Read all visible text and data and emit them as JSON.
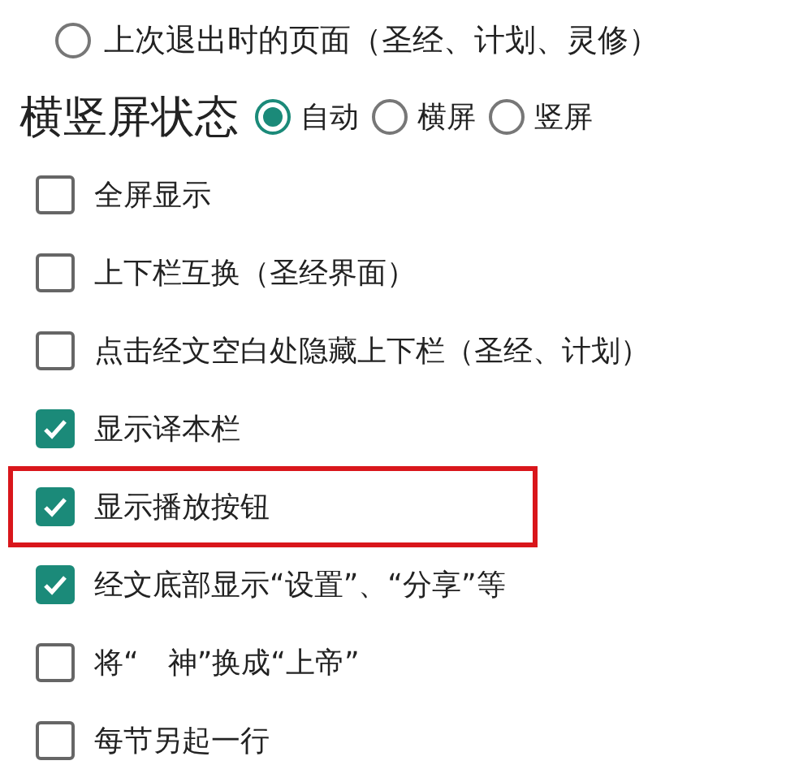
{
  "resume_option": {
    "label": "上次退出时的页面（圣经、计划、灵修）",
    "selected": false
  },
  "orientation": {
    "label": "横竖屏状态",
    "options": [
      {
        "label": "自动",
        "selected": true
      },
      {
        "label": "横屏",
        "selected": false
      },
      {
        "label": "竖屏",
        "selected": false
      }
    ]
  },
  "options": [
    {
      "label": "全屏显示",
      "checked": false,
      "highlighted": false
    },
    {
      "label": "上下栏互换（圣经界面）",
      "checked": false,
      "highlighted": false
    },
    {
      "label": "点击经文空白处隐藏上下栏（圣经、计划）",
      "checked": false,
      "highlighted": false
    },
    {
      "label": "显示译本栏",
      "checked": true,
      "highlighted": false
    },
    {
      "label": "显示播放按钮",
      "checked": true,
      "highlighted": true
    },
    {
      "label": "经文底部显示“设置”、“分享”等",
      "checked": true,
      "highlighted": false
    },
    {
      "label": "将“　神”换成“上帝”",
      "checked": false,
      "highlighted": false
    },
    {
      "label": "每节另起一行",
      "checked": false,
      "highlighted": false
    }
  ]
}
